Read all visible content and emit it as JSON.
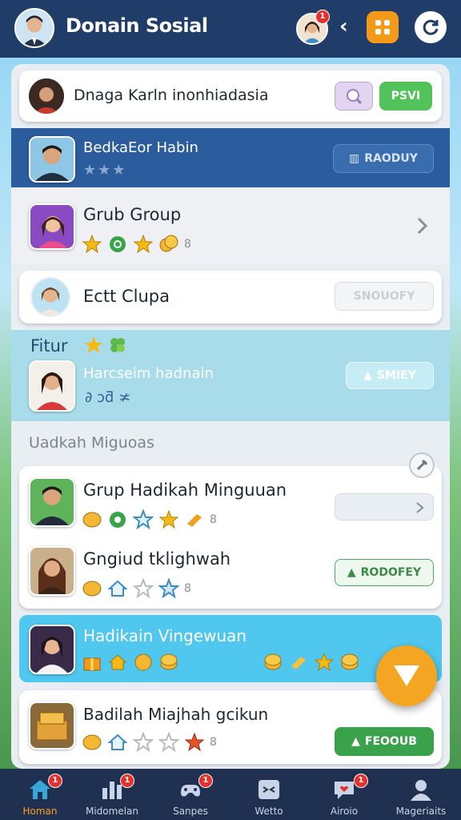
{
  "header": {
    "title": "Donain Sosial",
    "friend_badge": "1"
  },
  "top_card": {
    "name": "Dnaga Karln inonhiadasia",
    "action_label": "PSVI"
  },
  "highlight_row": {
    "name": "BedkaEor Habin",
    "action_label": "RAODUY"
  },
  "group_row": {
    "name": "Grub Group",
    "mini_text": "8"
  },
  "clupa_row": {
    "name": "Ectt Clupa",
    "action_label": "SNOUOFY"
  },
  "fitur": {
    "title": "Fitur",
    "name": "Harcseim hadnain",
    "action_label": "SMIEY",
    "icons_text": "∂ ɔƌ ≭"
  },
  "section": {
    "title": "Uadkah Miguoas"
  },
  "list": [
    {
      "name": "Grup Hadikah Minguuan",
      "mini_text": "8"
    },
    {
      "name": "Gngiud tklighwah",
      "action_label": "RODOFEY",
      "mini_text": "8"
    },
    {
      "name": "Hadikain Vingewuan"
    },
    {
      "name": "Badilah Miajhah gcikun",
      "action_label": "FEOOUB",
      "mini_text": "8"
    }
  ],
  "nav": [
    {
      "label": "Homan",
      "badge": "1"
    },
    {
      "label": "Midomelan",
      "badge": "1"
    },
    {
      "label": "Sanpes",
      "badge": "1"
    },
    {
      "label": "Wetto",
      "badge": ""
    },
    {
      "label": "Airoio",
      "badge": "1"
    },
    {
      "label": "Mageriaits",
      "badge": ""
    }
  ],
  "colors": {
    "topbar": "#1f3d68",
    "accent_green": "#3aa24a",
    "accent_orange": "#f4a521",
    "nav_bg": "#1f3050"
  }
}
